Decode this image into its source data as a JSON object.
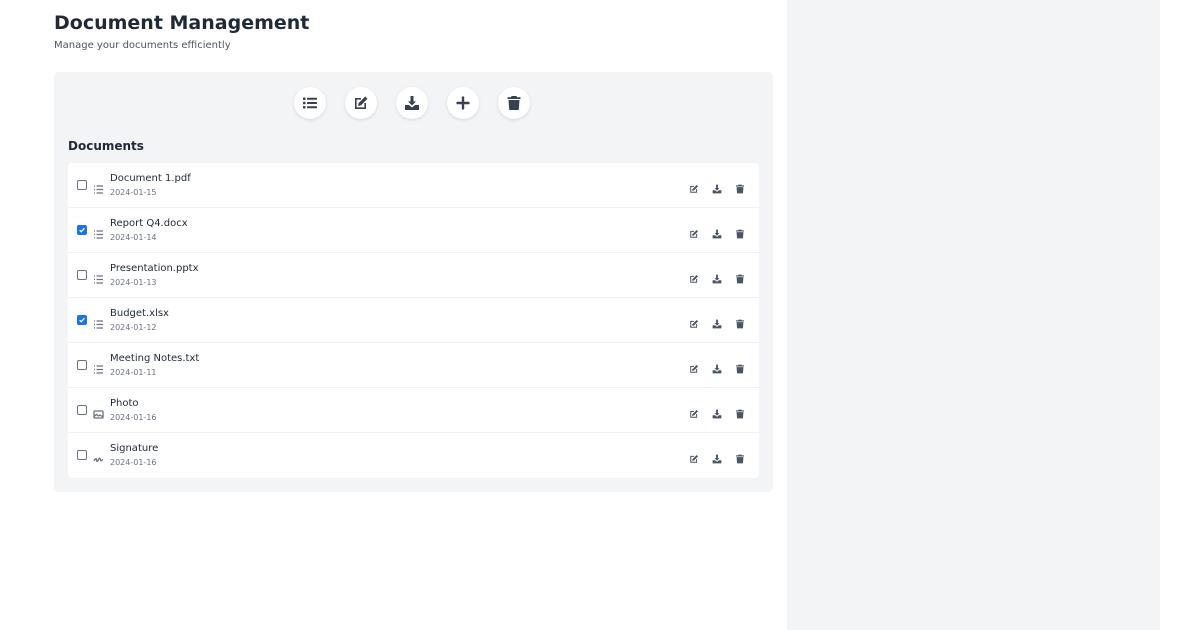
{
  "header": {
    "title": "Document Management",
    "subtitle": "Manage your documents efficiently"
  },
  "toolbar": {
    "buttons": [
      {
        "icon": "list-icon"
      },
      {
        "icon": "edit-icon"
      },
      {
        "icon": "download-icon"
      },
      {
        "icon": "plus-icon"
      },
      {
        "icon": "trash-icon"
      }
    ]
  },
  "documents": {
    "title": "Documents",
    "items": [
      {
        "name": "Document 1.pdf",
        "date": "2024-01-15",
        "checked": false,
        "icon": "list-icon"
      },
      {
        "name": "Report Q4.docx",
        "date": "2024-01-14",
        "checked": true,
        "icon": "list-icon"
      },
      {
        "name": "Presentation.pptx",
        "date": "2024-01-13",
        "checked": false,
        "icon": "list-icon"
      },
      {
        "name": "Budget.xlsx",
        "date": "2024-01-12",
        "checked": true,
        "icon": "list-icon"
      },
      {
        "name": "Meeting Notes.txt",
        "date": "2024-01-11",
        "checked": false,
        "icon": "list-icon"
      },
      {
        "name": "Photo",
        "date": "2024-01-16",
        "checked": false,
        "icon": "image-icon"
      },
      {
        "name": "Signature",
        "date": "2024-01-16",
        "checked": false,
        "icon": "signature-icon"
      }
    ]
  },
  "colors": {
    "accent": "#1a73e8",
    "panel_bg": "#f3f4f6",
    "text": "#1f2937"
  }
}
